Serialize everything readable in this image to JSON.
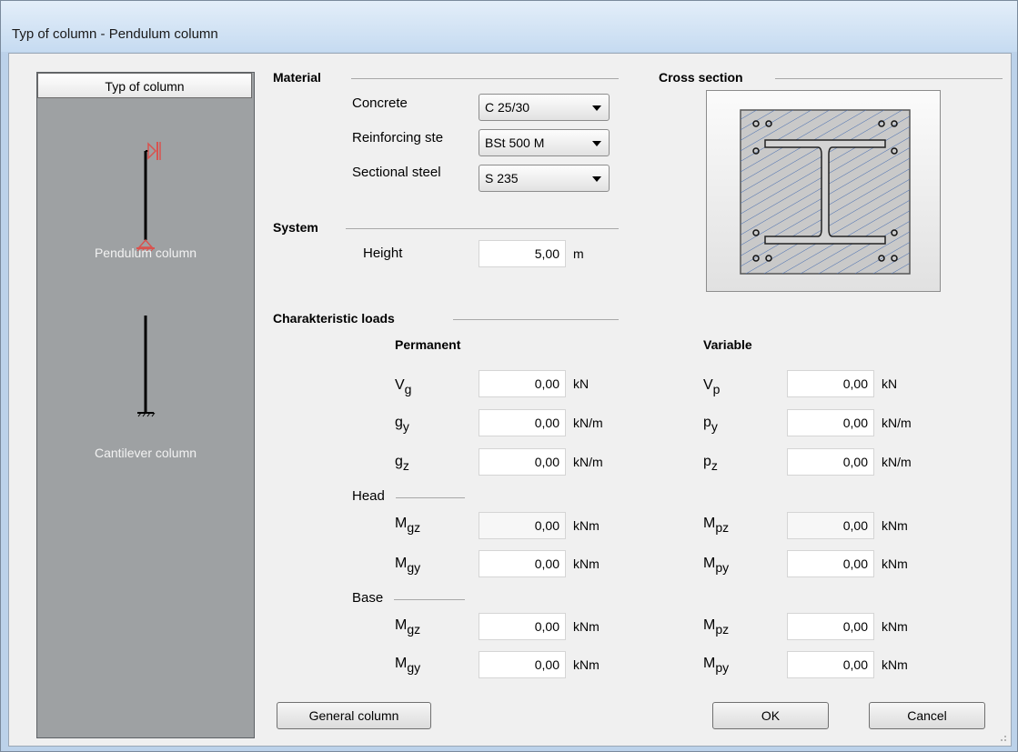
{
  "window": {
    "title": "Typ of column - Pendulum column"
  },
  "left_panel": {
    "header": "Typ of column",
    "options": [
      {
        "label": "Pendulum column",
        "icon": "pendulum-column-icon"
      },
      {
        "label": "Cantilever column",
        "icon": "cantilever-column-icon"
      }
    ]
  },
  "material": {
    "title": "Material",
    "concrete_label": "Concrete",
    "concrete_value": "C 25/30",
    "reinforcing_label": "Reinforcing ste",
    "reinforcing_value": "BSt 500 M",
    "sectional_label": "Sectional steel",
    "sectional_value": "S 235"
  },
  "system": {
    "title": "System",
    "height_label": "Height",
    "height_value": "5,00",
    "height_unit": "m"
  },
  "cross_section": {
    "title": "Cross section"
  },
  "loads": {
    "title": "Charakteristic loads",
    "permanent_title": "Permanent",
    "variable_title": "Variable",
    "head_label": "Head",
    "base_label": "Base",
    "permanent": {
      "vg": {
        "sym": "V",
        "sub": "g",
        "value": "0,00",
        "unit": "kN"
      },
      "gy": {
        "sym": "g",
        "sub": "y",
        "value": "0,00",
        "unit": "kN/m"
      },
      "gz": {
        "sym": "g",
        "sub": "z",
        "value": "0,00",
        "unit": "kN/m"
      },
      "head_mgz": {
        "sym": "M",
        "sub": "gz",
        "value": "0,00",
        "unit": "kNm"
      },
      "head_mgy": {
        "sym": "M",
        "sub": "gy",
        "value": "0,00",
        "unit": "kNm"
      },
      "base_mgz": {
        "sym": "M",
        "sub": "gz",
        "value": "0,00",
        "unit": "kNm"
      },
      "base_mgy": {
        "sym": "M",
        "sub": "gy",
        "value": "0,00",
        "unit": "kNm"
      }
    },
    "variable": {
      "vp": {
        "sym": "V",
        "sub": "p",
        "value": "0,00",
        "unit": "kN"
      },
      "py": {
        "sym": "p",
        "sub": "y",
        "value": "0,00",
        "unit": "kN/m"
      },
      "pz": {
        "sym": "p",
        "sub": "z",
        "value": "0,00",
        "unit": "kN/m"
      },
      "head_mpz": {
        "sym": "M",
        "sub": "pz",
        "value": "0,00",
        "unit": "kNm"
      },
      "head_mpy": {
        "sym": "M",
        "sub": "py",
        "value": "0,00",
        "unit": "kNm"
      },
      "base_mpz": {
        "sym": "M",
        "sub": "pz",
        "value": "0,00",
        "unit": "kNm"
      },
      "base_mpy": {
        "sym": "M",
        "sub": "py",
        "value": "0,00",
        "unit": "kNm"
      }
    }
  },
  "buttons": {
    "general": "General column",
    "ok": "OK",
    "cancel": "Cancel"
  },
  "colors": {
    "support_red": "#d9534f",
    "panel_gray": "#9ea1a3",
    "hatch_blue": "#4a6fb0"
  }
}
